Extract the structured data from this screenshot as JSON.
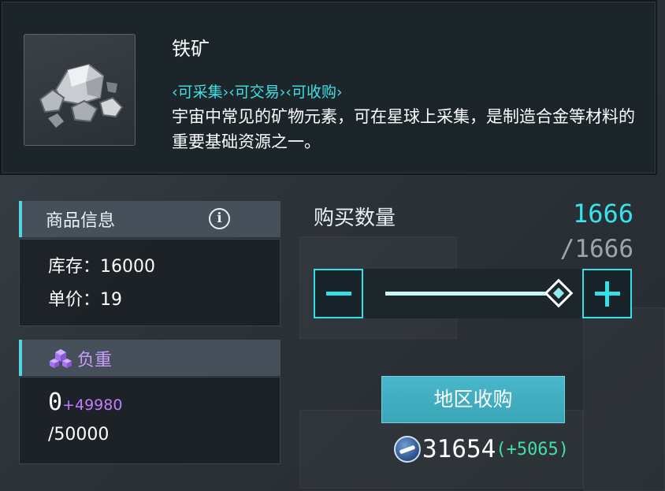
{
  "item": {
    "name": "铁矿",
    "tags": "‹可采集›‹可交易›‹可收购›",
    "description": "宇宙中常见的矿物元素，可在星球上采集，是制造合金等材料的重要基础资源之一。",
    "icon": "iron-ore-icon"
  },
  "goods_info": {
    "title": "商品信息",
    "stock": "库存：16000",
    "unit_price": "单价：19",
    "icon": "info-icon"
  },
  "load": {
    "title": "负重",
    "current": "0",
    "delta": "+49980",
    "max": "/50000",
    "icon": "cubes-icon"
  },
  "purchase": {
    "qty_label": "购买数量",
    "qty_value": "1666",
    "qty_max": "/1666",
    "slider_fraction": 1.0,
    "minus_icon": "minus-icon",
    "plus_icon": "plus-icon",
    "button_label": "地区收购"
  },
  "currency": {
    "amount": "31654",
    "delta": "(+5065)",
    "icon": "credits-coin-icon"
  },
  "colors": {
    "accent": "#35dfe6",
    "tag": "#3fe0e6",
    "load": "#c89bff",
    "gain": "#3fe0a8"
  }
}
